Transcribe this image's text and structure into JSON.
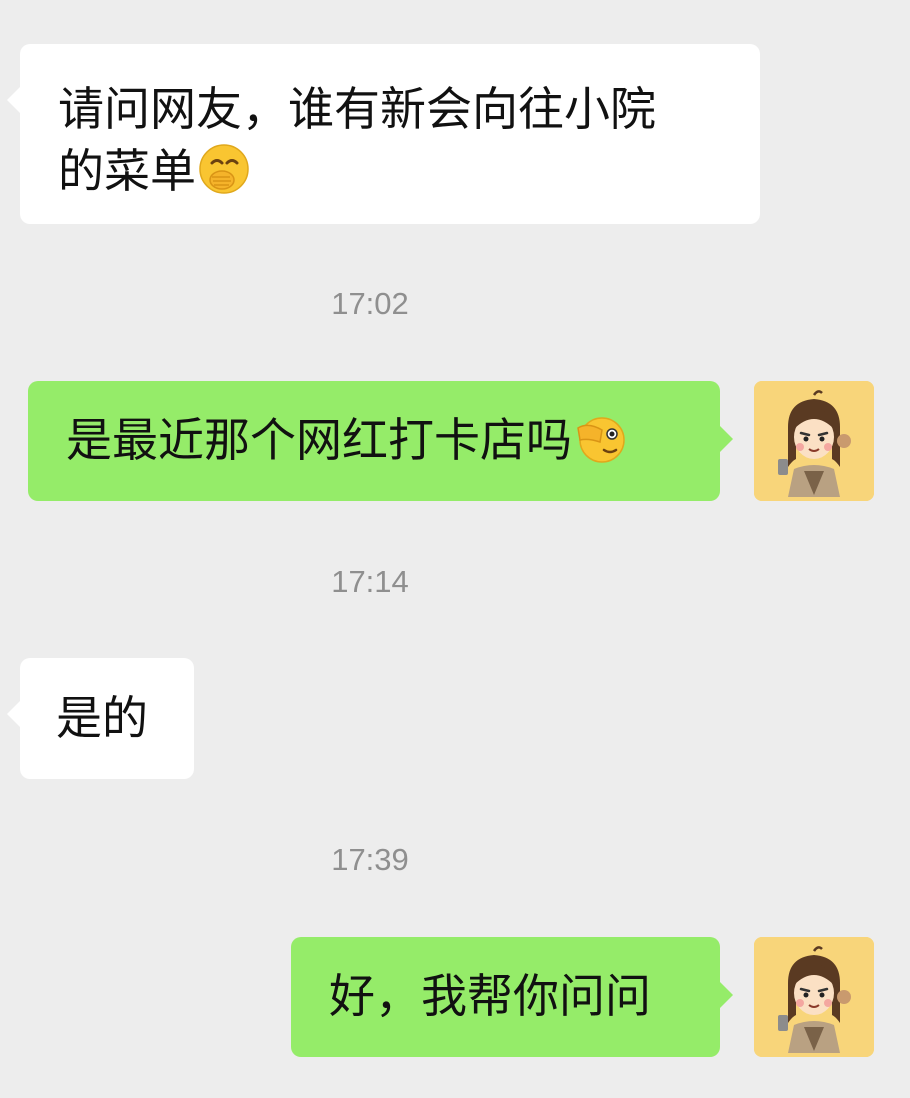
{
  "chat": {
    "messages": [
      {
        "side": "in",
        "text": "请问网友，谁有新会向往小院的菜单",
        "line1": "请问网友，谁有新会向往小院",
        "line2": "的菜单",
        "emoji": "hand-over-mouth-emoji"
      },
      {
        "time": "17:02"
      },
      {
        "side": "out",
        "text": "是最近那个网红打卡店吗",
        "emoji": "saluting-face-emoji"
      },
      {
        "time": "17:14"
      },
      {
        "side": "in",
        "text": "是的"
      },
      {
        "time": "17:39"
      },
      {
        "side": "out",
        "text": "好，我帮你问问"
      }
    ],
    "colors": {
      "background": "#ededed",
      "incoming_bubble": "#ffffff",
      "outgoing_bubble": "#95ec69",
      "timestamp": "#8f8f8f",
      "avatar_bg": "#f8d57a"
    },
    "avatar": "cartoon-character-avatar"
  }
}
